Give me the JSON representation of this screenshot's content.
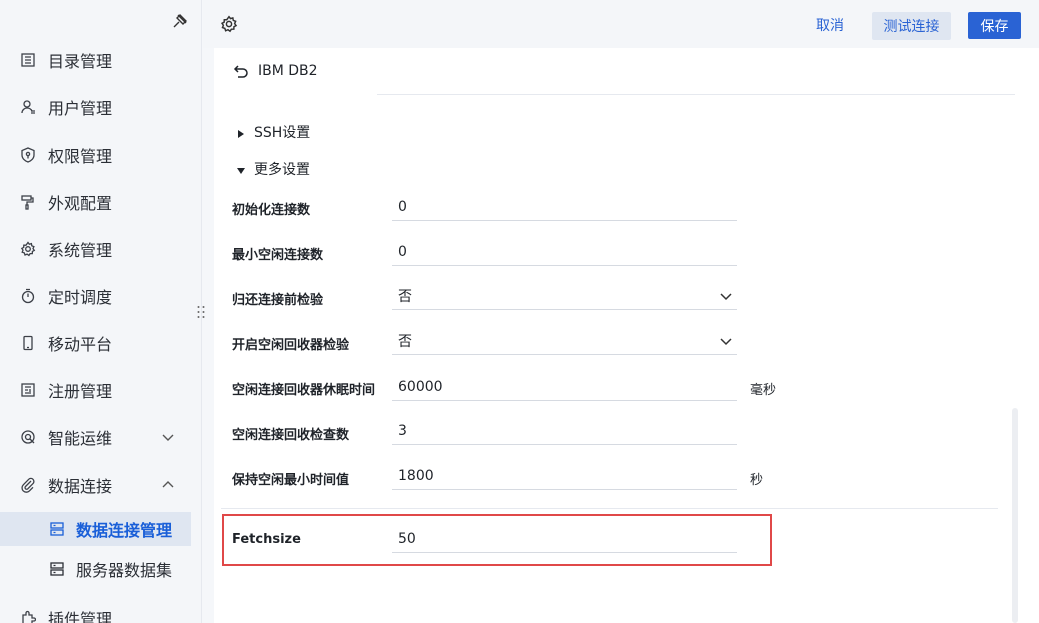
{
  "sidebar": {
    "items": [
      {
        "label": "目录管理",
        "icon": "catalog-icon"
      },
      {
        "label": "用户管理",
        "icon": "user-icon"
      },
      {
        "label": "权限管理",
        "icon": "shield-icon"
      },
      {
        "label": "外观配置",
        "icon": "paint-roller-icon"
      },
      {
        "label": "系统管理",
        "icon": "gear-icon"
      },
      {
        "label": "定时调度",
        "icon": "timer-icon"
      },
      {
        "label": "移动平台",
        "icon": "mobile-icon"
      },
      {
        "label": "注册管理",
        "icon": "register-icon"
      },
      {
        "label": "智能运维",
        "icon": "ops-icon"
      },
      {
        "label": "数据连接",
        "icon": "paperclip-icon"
      },
      {
        "label": "插件管理",
        "icon": "plugin-icon"
      }
    ],
    "sub_items": [
      {
        "label": "数据连接管理",
        "active": true
      },
      {
        "label": "服务器数据集",
        "active": false
      }
    ]
  },
  "toolbar": {
    "cancel_label": "取消",
    "test_label": "测试连接",
    "save_label": "保存"
  },
  "header": {
    "title": "IBM DB2"
  },
  "sections": {
    "ssh": "SSH设置",
    "more": "更多设置"
  },
  "form": {
    "rows": [
      {
        "label": "初始化连接数",
        "value": "0",
        "unit": ""
      },
      {
        "label": "最小空闲连接数",
        "value": "0",
        "unit": ""
      },
      {
        "label": "归还连接前检验",
        "value": "否",
        "unit": ""
      },
      {
        "label": "开启空闲回收器检验",
        "value": "否",
        "unit": ""
      },
      {
        "label": "空闲连接回收器休眠时间",
        "value": "60000",
        "unit": "毫秒"
      },
      {
        "label": "空闲连接回收检查数",
        "value": "3",
        "unit": ""
      },
      {
        "label": "保持空闲最小时间值",
        "value": "1800",
        "unit": "秒"
      },
      {
        "label": "Fetchsize",
        "value": "50",
        "unit": ""
      }
    ]
  },
  "colors": {
    "accent": "#2a63d4",
    "highlight": "#e04848",
    "sidebar_bg": "#f4f6f9"
  }
}
